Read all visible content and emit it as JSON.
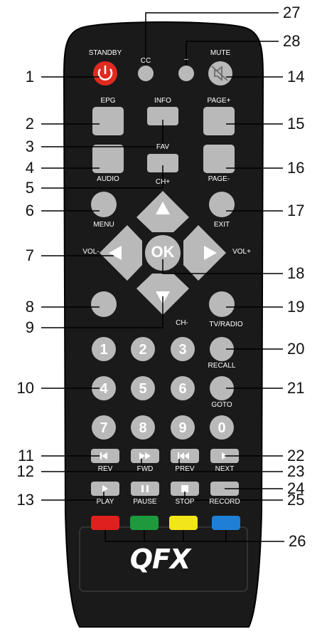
{
  "remote": {
    "body_color": "#1a1a1a",
    "button_color": "#b9b9b9",
    "label_color": "#ffffff",
    "brand": "QFX",
    "labels": {
      "cc": "CC",
      "dash": "–",
      "standby": "STANDBY",
      "mute": "MUTE",
      "epg": "EPG",
      "info": "INFO",
      "page_up": "PAGE+",
      "fav": "FAV",
      "audio": "AUDIO",
      "page_down": "PAGE-",
      "ch_up": "CH+",
      "menu": "MENU",
      "exit": "EXIT",
      "vol_minus": "VOL-",
      "vol_plus": "VOL+",
      "ok": "OK",
      "ch_down": "CH-",
      "tv_radio": "TV/RADIO",
      "recall": "RECALL",
      "goto": "GOTO",
      "rev": "REV",
      "fwd": "FWD",
      "prev": "PREV",
      "next": "NEXT",
      "play": "PLAY",
      "pause": "PAUSE",
      "stop": "STOP",
      "record": "RECORD"
    },
    "number_keys": [
      "1",
      "2",
      "3",
      "4",
      "5",
      "6",
      "7",
      "8",
      "9",
      "0"
    ],
    "color_keys": [
      {
        "name": "red",
        "color": "#e0201e"
      },
      {
        "name": "green",
        "color": "#1e9a3c"
      },
      {
        "name": "yellow",
        "color": "#f2e51a"
      },
      {
        "name": "blue",
        "color": "#1f7fd6"
      }
    ]
  },
  "callouts": {
    "left": [
      "1",
      "2",
      "3",
      "4",
      "5",
      "6",
      "7",
      "8",
      "9",
      "10",
      "11",
      "12",
      "13"
    ],
    "right": [
      "27",
      "28",
      "14",
      "15",
      "16",
      "17",
      "18",
      "19",
      "20",
      "21",
      "22",
      "23",
      "24",
      "25",
      "26"
    ]
  }
}
